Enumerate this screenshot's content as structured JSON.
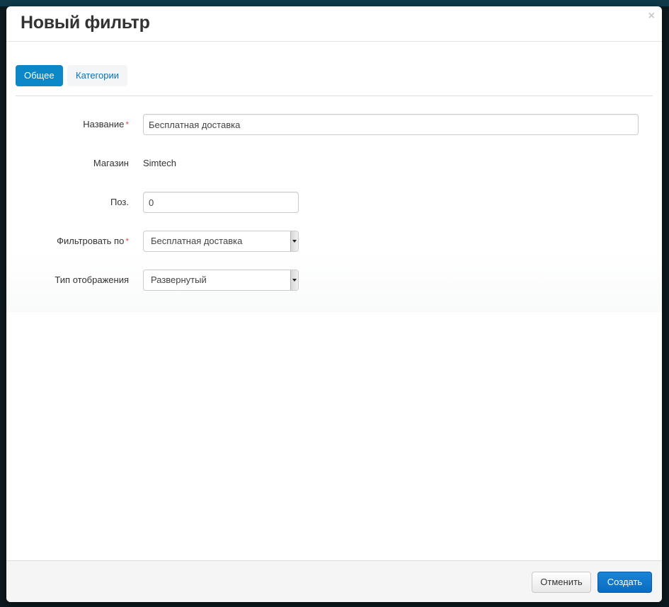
{
  "modal": {
    "title": "Новый фильтр",
    "close_symbol": "×"
  },
  "tabs": [
    {
      "label": "Общее",
      "active": true
    },
    {
      "label": "Категории",
      "active": false
    }
  ],
  "form": {
    "name": {
      "label": "Название",
      "required_mark": "*",
      "value": "Бесплатная доставка"
    },
    "store": {
      "label": "Магазин",
      "value": "Simtech"
    },
    "position": {
      "label": "Поз.",
      "value": "0"
    },
    "filter_by": {
      "label": "Фильтровать по",
      "required_mark": "*",
      "selected": "Бесплатная доставка"
    },
    "display_type": {
      "label": "Тип отображения",
      "selected": "Развернутый"
    }
  },
  "footer": {
    "cancel_label": "Отменить",
    "create_label": "Создать"
  },
  "colors": {
    "primary": "#0b87c8",
    "create_button": "#0b6bc0",
    "required": "#d9534f"
  },
  "icons": {
    "close": "close-icon",
    "select_arrow": "chevron-down-icon"
  }
}
